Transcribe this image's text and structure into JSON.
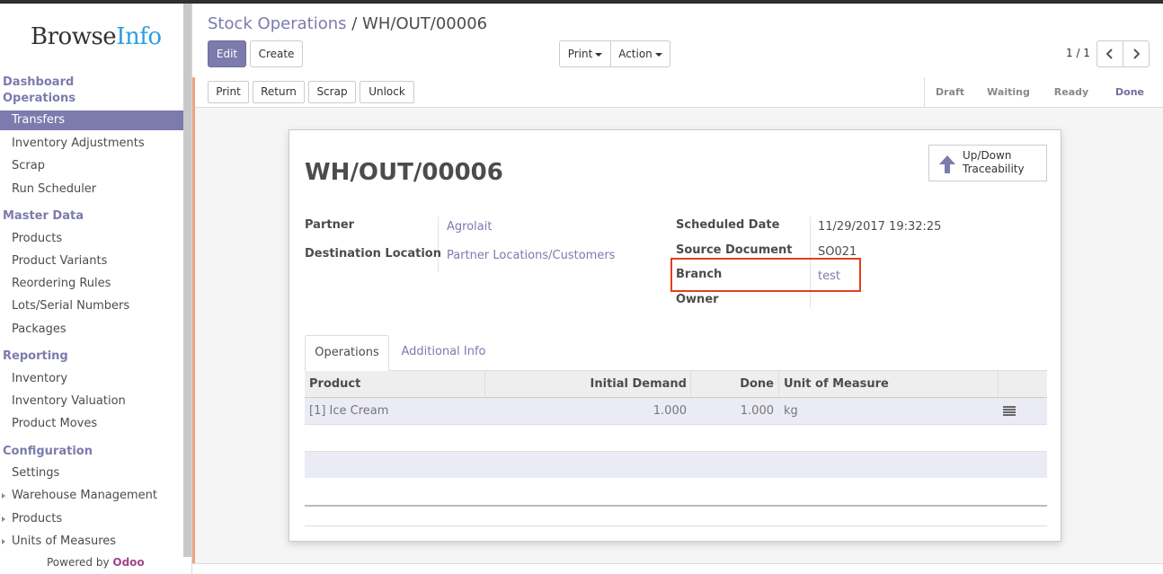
{
  "app": {
    "logo_part1": "Browse",
    "logo_part2": "Info",
    "powered_by_prefix": "Powered by",
    "powered_by_brand": "Odoo"
  },
  "sidebar": {
    "sections": [
      {
        "label": "Dashboard"
      },
      {
        "label": "Operations"
      },
      {
        "label": "Master Data"
      },
      {
        "label": "Reporting"
      },
      {
        "label": "Configuration"
      }
    ],
    "items": {
      "transfers": "Transfers",
      "inventory_adjustments": "Inventory Adjustments",
      "scrap": "Scrap",
      "run_scheduler": "Run Scheduler",
      "products": "Products",
      "product_variants": "Product Variants",
      "reordering_rules": "Reordering Rules",
      "lots_serial": "Lots/Serial Numbers",
      "packages": "Packages",
      "inventory": "Inventory",
      "inventory_valuation": "Inventory Valuation",
      "product_moves": "Product Moves",
      "settings": "Settings",
      "warehouse_management": "Warehouse Management",
      "config_products": "Products",
      "units_of_measures": "Units of Measures"
    },
    "active_item": "Transfers"
  },
  "header": {
    "breadcrumb_parent": "Stock Operations",
    "breadcrumb_sep": "/",
    "breadcrumb_current": "WH/OUT/00006",
    "edit_label": "Edit",
    "create_label": "Create",
    "print_label": "Print",
    "action_label": "Action",
    "pager": "1 / 1",
    "prev_icon": "chevron-left-icon",
    "next_icon": "chevron-right-icon"
  },
  "statusbar": {
    "buttons": [
      "Print",
      "Return",
      "Scrap",
      "Unlock"
    ],
    "stages": [
      "Draft",
      "Waiting",
      "Ready",
      "Done"
    ],
    "current_stage": "Done"
  },
  "form": {
    "title": "WH/OUT/00006",
    "traceability_label": "Up/Down Traceability",
    "partner_label": "Partner",
    "partner_value": "Agrolait",
    "dest_label": "Destination Location",
    "dest_value": "Partner Locations/Customers",
    "sched_label": "Scheduled Date",
    "sched_value": "11/29/2017 19:32:25",
    "source_label": "Source Document",
    "source_value": "SO021",
    "branch_label": "Branch",
    "branch_value": "test",
    "owner_label": "Owner",
    "owner_value": ""
  },
  "tabs": [
    {
      "label": "Operations",
      "active": true
    },
    {
      "label": "Additional Info",
      "active": false
    }
  ],
  "table": {
    "columns": [
      "Product",
      "Initial Demand",
      "Done",
      "Unit of Measure"
    ],
    "rows": [
      {
        "product": "[1] Ice Cream",
        "initial_demand": "1.000",
        "done": "1.000",
        "uom": "kg"
      }
    ]
  },
  "colors": {
    "accent": "#7c7bad",
    "highlight_box": "#e0401d",
    "brand_blue": "#2e9de0"
  }
}
